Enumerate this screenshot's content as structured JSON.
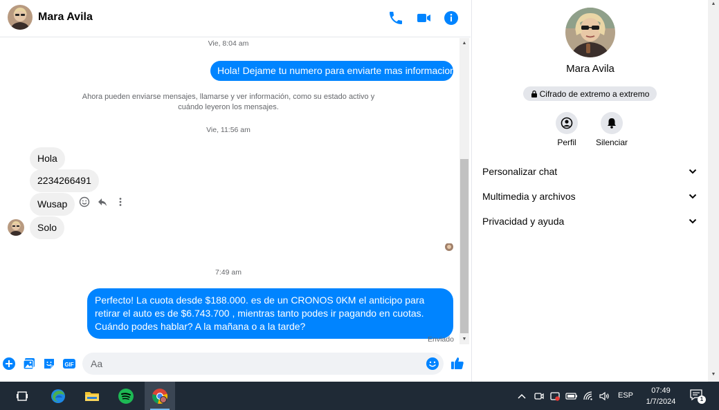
{
  "header": {
    "contact_name": "Mara Avila"
  },
  "chat": {
    "messages": [
      {
        "kind": "timestamp",
        "text": "Vie, 8:04 am"
      },
      {
        "kind": "outgoing",
        "text": "Hola! Dejame tu numero para enviarte mas informacion"
      },
      {
        "kind": "system",
        "text": "Ahora pueden enviarse mensajes, llamarse y ver información, como su estado activo y cuándo leyeron los mensajes."
      },
      {
        "kind": "timestamp",
        "text": "Vie, 11:56 am"
      },
      {
        "kind": "incoming",
        "text": "Hola"
      },
      {
        "kind": "incoming",
        "text": "2234266491"
      },
      {
        "kind": "incoming",
        "text": "Wusap"
      },
      {
        "kind": "incoming",
        "text": "Solo"
      },
      {
        "kind": "timestamp",
        "text": "7:49 am"
      },
      {
        "kind": "outgoing",
        "text": "Perfecto! La cuota desde $188.000. es de un CRONOS 0KM el anticipo para retirar el auto es de $6.743.700 , mientras tanto podes ir pagando en cuotas. Cuándo podes hablar? A la mañana o a la tarde?"
      }
    ],
    "sent_status": "Enviado"
  },
  "composer": {
    "placeholder": "Aa"
  },
  "right_panel": {
    "name": "Mara Avila",
    "encryption_badge": "Cifrado de extremo a extremo",
    "actions": [
      {
        "label": "Perfil",
        "icon": "profile-icon"
      },
      {
        "label": "Silenciar",
        "icon": "bell-icon"
      }
    ],
    "sections": [
      {
        "label": "Personalizar chat"
      },
      {
        "label": "Multimedia y archivos"
      },
      {
        "label": "Privacidad y ayuda"
      }
    ]
  },
  "taskbar": {
    "apps": [
      {
        "name": "task-view",
        "icon": "task-view-icon"
      },
      {
        "name": "edge",
        "icon": "edge-icon"
      },
      {
        "name": "file-explorer",
        "icon": "folder-icon"
      },
      {
        "name": "spotify",
        "icon": "spotify-icon"
      },
      {
        "name": "chrome",
        "icon": "chrome-icon"
      }
    ],
    "language": "ESP",
    "time": "07:49",
    "date": "1/7/2024",
    "notification_count": "1"
  },
  "colors": {
    "accent": "#0084ff",
    "incoming_bubble": "#f0f0f0",
    "taskbar": "#1f2a36"
  }
}
